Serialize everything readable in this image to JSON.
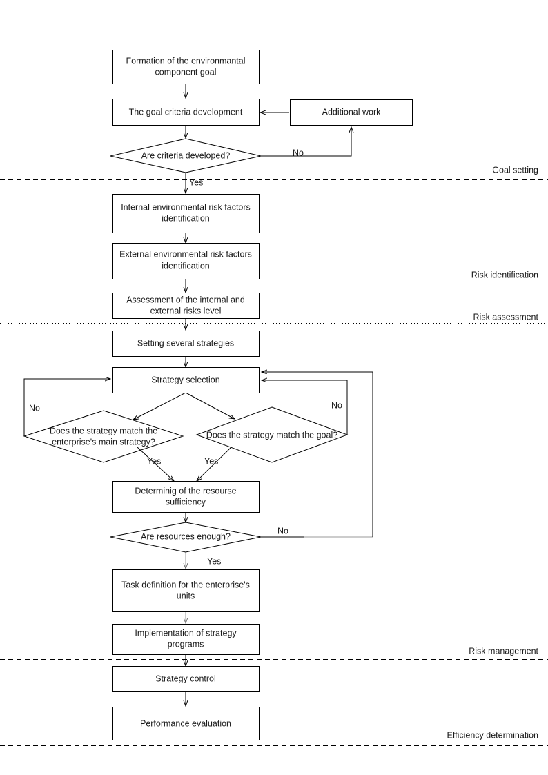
{
  "diagram": {
    "title": "Environmental component risk management process flowchart",
    "type": "flowchart",
    "colors": {
      "stroke": "#000000",
      "fill": "#ffffff",
      "text": "#1a1a1a",
      "gray_edge": "#9a9a9a"
    },
    "nodes": [
      {
        "id": "n1",
        "shape": "process",
        "lines": [
          "Formation of the environmantal",
          "component goal"
        ]
      },
      {
        "id": "n2",
        "shape": "process",
        "lines": [
          "The goal criteria development"
        ]
      },
      {
        "id": "n3",
        "shape": "process",
        "lines": [
          "Additional work"
        ]
      },
      {
        "id": "d1",
        "shape": "decision",
        "lines": [
          "Are criteria developed?"
        ]
      },
      {
        "id": "n4",
        "shape": "process",
        "lines": [
          "Internal environmental risk factors",
          "identification"
        ]
      },
      {
        "id": "n5",
        "shape": "process",
        "lines": [
          "External environmental risk factors",
          "identification"
        ]
      },
      {
        "id": "n6",
        "shape": "process",
        "lines": [
          "Assessment of the internal and",
          "external risks level"
        ]
      },
      {
        "id": "n7",
        "shape": "process",
        "lines": [
          "Setting several strategies"
        ]
      },
      {
        "id": "n8",
        "shape": "process",
        "lines": [
          "Strategy selection"
        ]
      },
      {
        "id": "d2",
        "shape": "decision",
        "lines": [
          "Does the strategy match the",
          "enterprise's main strategy?"
        ]
      },
      {
        "id": "d3",
        "shape": "decision",
        "lines": [
          "Does the strategy match the goal?"
        ]
      },
      {
        "id": "n9",
        "shape": "process",
        "lines": [
          "Determinig of the resourse",
          "sufficiency"
        ]
      },
      {
        "id": "d4",
        "shape": "decision",
        "lines": [
          "Are resources enough?"
        ]
      },
      {
        "id": "n10",
        "shape": "process",
        "lines": [
          "Task definition for the enterprise's",
          "units"
        ]
      },
      {
        "id": "n11",
        "shape": "process",
        "lines": [
          "Implementation of strategy",
          "programs"
        ]
      },
      {
        "id": "n12",
        "shape": "process",
        "lines": [
          "Strategy control"
        ]
      },
      {
        "id": "n13",
        "shape": "process",
        "lines": [
          "Performance evaluation"
        ]
      }
    ],
    "edge_labels": {
      "criteria_no": "No",
      "criteria_yes": "Yes",
      "main_strategy_no": "No",
      "main_strategy_yes": "Yes",
      "goal_no": "No",
      "goal_yes": "Yes",
      "resources_no": "No",
      "resources_yes": "Yes"
    },
    "phases": [
      {
        "id": "p1",
        "label": "Goal setting",
        "line_style": "dashed"
      },
      {
        "id": "p2",
        "label": "Risk identification",
        "line_style": "dotted"
      },
      {
        "id": "p3",
        "label": "Risk assessment",
        "line_style": "dotted"
      },
      {
        "id": "p4",
        "label": "Risk management",
        "line_style": "dashed"
      },
      {
        "id": "p5",
        "label": "Efficiency determination",
        "line_style": "dashed"
      }
    ]
  }
}
